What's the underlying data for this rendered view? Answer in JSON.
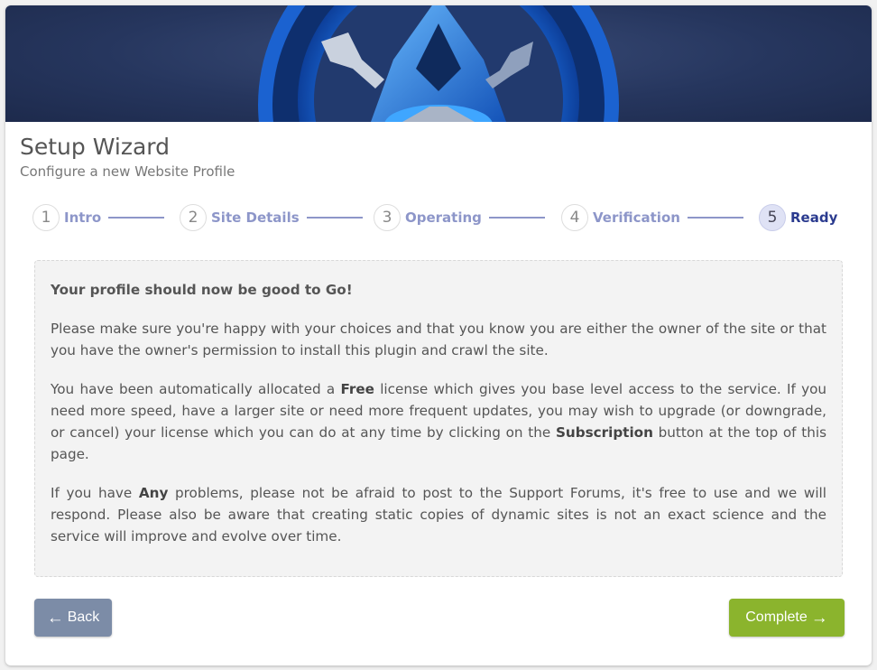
{
  "header": {
    "title": "Setup Wizard",
    "subtitle": "Configure a new Website Profile"
  },
  "steps": [
    {
      "number": "1",
      "label": "Intro",
      "active": false
    },
    {
      "number": "2",
      "label": "Site Details",
      "active": false
    },
    {
      "number": "3",
      "label": "Operating",
      "active": false
    },
    {
      "number": "4",
      "label": "Verification",
      "active": false
    },
    {
      "number": "5",
      "label": "Ready",
      "active": true
    }
  ],
  "message": {
    "lead": "Your profile should now be good to Go!",
    "p1": "Please make sure you're happy with your choices and that you know you are either the owner of the site or that you have the owner's permission to install this plugin and crawl the site.",
    "p2_a": "You have been automatically allocated a ",
    "p2_b": "Free",
    "p2_c": " license which gives you base level access to the service. If you need more speed, have a larger site or need more frequent updates, you may wish to upgrade (or downgrade, or cancel) your license which you can do at any time by clicking on the ",
    "p2_d": "Subscription",
    "p2_e": " button at the top of this page.",
    "p3_a": "If you have ",
    "p3_b": "Any",
    "p3_c": " problems, please not be afraid to post to the Support Forums, it's free to use and we will respond. Please also be aware that creating static copies of dynamic sites is not an exact science and the service will improve and evolve over time."
  },
  "buttons": {
    "back": "Back",
    "complete": "Complete"
  },
  "icons": {
    "back": "arrow-left-icon",
    "complete": "arrow-right-icon"
  },
  "colors": {
    "step_accent": "#8d96c9",
    "step_active": "#2b3b8f",
    "back_button": "#7c8ca7",
    "complete_button": "#8bb42d"
  }
}
